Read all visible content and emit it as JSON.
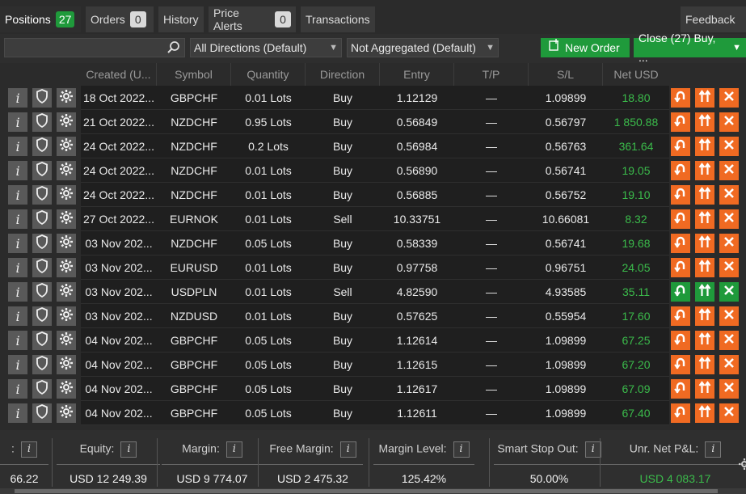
{
  "tabs": [
    {
      "label": "Positions",
      "count": "27",
      "active": true
    },
    {
      "label": "Orders",
      "count": "0"
    },
    {
      "label": "History"
    },
    {
      "label": "Price Alerts",
      "count": "0"
    },
    {
      "label": "Transactions"
    }
  ],
  "feedback_label": "Feedback",
  "filters": {
    "search_placeholder": "",
    "direction": "All Directions (Default)",
    "aggregation": "Not Aggregated (Default)",
    "new_order": "New Order",
    "close_all": "Close (27) Buy, ..."
  },
  "columns": [
    "Created (U...",
    "Symbol",
    "Quantity",
    "Direction",
    "Entry",
    "T/P",
    "S/L",
    "Net USD"
  ],
  "rows": [
    {
      "created": "18 Oct 2022...",
      "symbol": "GBPCHF",
      "qty": "0.01 Lots",
      "dir": "Buy",
      "entry": "1.12129",
      "tp": "—",
      "sl": "1.09899",
      "net": "18.80"
    },
    {
      "created": "21 Oct 2022...",
      "symbol": "NZDCHF",
      "qty": "0.95 Lots",
      "dir": "Buy",
      "entry": "0.56849",
      "tp": "—",
      "sl": "0.56797",
      "net": "1 850.88"
    },
    {
      "created": "24 Oct 2022...",
      "symbol": "NZDCHF",
      "qty": "0.2 Lots",
      "dir": "Buy",
      "entry": "0.56984",
      "tp": "—",
      "sl": "0.56763",
      "net": "361.64"
    },
    {
      "created": "24 Oct 2022...",
      "symbol": "NZDCHF",
      "qty": "0.01 Lots",
      "dir": "Buy",
      "entry": "0.56890",
      "tp": "—",
      "sl": "0.56741",
      "net": "19.05"
    },
    {
      "created": "24 Oct 2022...",
      "symbol": "NZDCHF",
      "qty": "0.01 Lots",
      "dir": "Buy",
      "entry": "0.56885",
      "tp": "—",
      "sl": "0.56752",
      "net": "19.10"
    },
    {
      "created": "27 Oct 2022...",
      "symbol": "EURNOK",
      "qty": "0.01 Lots",
      "dir": "Sell",
      "entry": "10.33751",
      "tp": "—",
      "sl": "10.66081",
      "net": "8.32"
    },
    {
      "created": "03 Nov 202...",
      "symbol": "NZDCHF",
      "qty": "0.05 Lots",
      "dir": "Buy",
      "entry": "0.58339",
      "tp": "—",
      "sl": "0.56741",
      "net": "19.68"
    },
    {
      "created": "03 Nov 202...",
      "symbol": "EURUSD",
      "qty": "0.01 Lots",
      "dir": "Buy",
      "entry": "0.97758",
      "tp": "—",
      "sl": "0.96751",
      "net": "24.05"
    },
    {
      "created": "03 Nov 202...",
      "symbol": "USDPLN",
      "qty": "0.01 Lots",
      "dir": "Sell",
      "entry": "4.82590",
      "tp": "—",
      "sl": "4.93585",
      "net": "35.11",
      "green_actions": true
    },
    {
      "created": "03 Nov 202...",
      "symbol": "NZDUSD",
      "qty": "0.01 Lots",
      "dir": "Buy",
      "entry": "0.57625",
      "tp": "—",
      "sl": "0.55954",
      "net": "17.60"
    },
    {
      "created": "04 Nov 202...",
      "symbol": "GBPCHF",
      "qty": "0.05 Lots",
      "dir": "Buy",
      "entry": "1.12614",
      "tp": "—",
      "sl": "1.09899",
      "net": "67.25"
    },
    {
      "created": "04 Nov 202...",
      "symbol": "GBPCHF",
      "qty": "0.05 Lots",
      "dir": "Buy",
      "entry": "1.12615",
      "tp": "—",
      "sl": "1.09899",
      "net": "67.20"
    },
    {
      "created": "04 Nov 202...",
      "symbol": "GBPCHF",
      "qty": "0.05 Lots",
      "dir": "Buy",
      "entry": "1.12617",
      "tp": "—",
      "sl": "1.09899",
      "net": "67.09"
    },
    {
      "created": "04 Nov 202...",
      "symbol": "GBPCHF",
      "qty": "0.05 Lots",
      "dir": "Buy",
      "entry": "1.12611",
      "tp": "—",
      "sl": "1.09899",
      "net": "67.40"
    }
  ],
  "footer": [
    {
      "label": ":",
      "value": "66.22"
    },
    {
      "label": "Equity:",
      "value": "USD 12 249.39"
    },
    {
      "label": "Margin:",
      "value": "USD 9 774.07"
    },
    {
      "label": "Free Margin:",
      "value": "USD 2 475.32"
    },
    {
      "label": "Margin Level:",
      "value": "125.42%"
    },
    {
      "label": "Smart Stop Out:",
      "value": "50.00%"
    },
    {
      "label": "Unr. Net P&L:",
      "value": "USD 4 083.17",
      "green": true
    }
  ],
  "colors": {
    "accent_green": "#1f9a3b",
    "action_orange": "#f06a22",
    "pl_green": "#3bbb4b"
  },
  "icons": {
    "info": "info-icon",
    "protect": "shield-icon",
    "settings": "gear-icon",
    "reverse": "reverse-icon",
    "double_up": "double-arrow-up-icon",
    "close": "close-icon",
    "search": "search-icon",
    "new_order": "new-order-icon"
  }
}
